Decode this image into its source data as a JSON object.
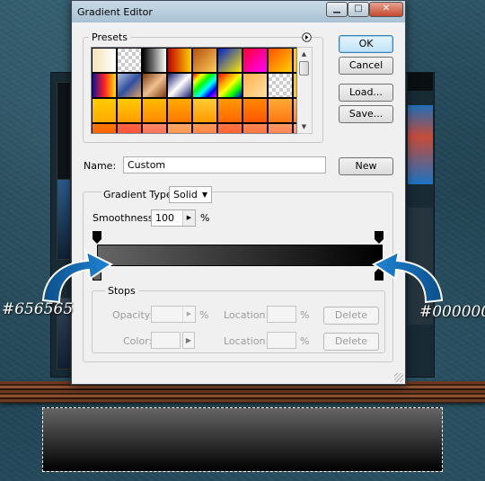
{
  "window": {
    "title": "Gradient Editor",
    "controls": {
      "minimize": "▁",
      "maximize": "□",
      "close": "✕"
    }
  },
  "presets": {
    "legend": "Presets",
    "menu_icon": "circle-arrow-icon",
    "swatches": [
      "linear-gradient(90deg,#f5e3b8,#ffffff)",
      "checker",
      "linear-gradient(90deg,#000,#fff)",
      "linear-gradient(90deg,#c00000,#ffd000)",
      "linear-gradient(135deg,#b45010,#ffcc55)",
      "linear-gradient(135deg,#0020d0,#ffeb00)",
      "linear-gradient(135deg,#ff0030,#ff00ff)",
      "linear-gradient(135deg,#ff5000,#ffd000)",
      "linear-gradient(90deg,#ffd000,#ff8000)",
      "linear-gradient(90deg,#1010a0,#ff2020,#ffe000)",
      "linear-gradient(135deg,#b0c0e0,#3050a0,#e0a060)",
      "linear-gradient(135deg,#7a3a10,#f0c090,#7a3a10)",
      "linear-gradient(135deg,#1a1a6e,#fff 50%,#1a1a6e)",
      "linear-gradient(135deg,#ff0000,#ffff00,#00ff00,#00ffff,#0000ff,#ff00ff)",
      "linear-gradient(135deg,#ff0000,#ff8800,#ffff00,#00ff00,#0000ff)",
      "linear-gradient(135deg,#ffb050,#ffe0a0)",
      "checker",
      "linear-gradient(90deg,#ffd000,#ff9000)",
      "linear-gradient(#ffcc00,#ffaa00)",
      "linear-gradient(#ffcc00,#ff9900)",
      "linear-gradient(#ffbb00,#ff8800)",
      "linear-gradient(#ffaa00,#ff7700)",
      "linear-gradient(#ffcc33,#ff9900)",
      "linear-gradient(#ff9900,#ff6600)",
      "linear-gradient(#ff8800,#ff5500)",
      "linear-gradient(#ffaa33,#ff7711)",
      "linear-gradient(#ffbb44,#ff8822)",
      "linear-gradient(#ff7700,#ff4400)",
      "linear-gradient(#ff6644,#ff3322)",
      "linear-gradient(#ff8866,#ff5544)",
      "linear-gradient(#ffaa66,#ff7733)",
      "linear-gradient(#ff9955,#ff6622)",
      "linear-gradient(#ff7744,#ff4411)",
      "linear-gradient(#ff8855,#ff5522)",
      "linear-gradient(#ff9966,#ff6633)",
      "linear-gradient(#ffaa77,#ff7744)"
    ]
  },
  "buttons": {
    "ok": "OK",
    "cancel": "Cancel",
    "load": "Load...",
    "save": "Save...",
    "new": "New"
  },
  "name": {
    "label": "Name:",
    "value": "Custom"
  },
  "gradient": {
    "type_label": "Gradient Type:",
    "type_value": "Solid",
    "smoothness_label": "Smoothness:",
    "smoothness_value": "100",
    "smoothness_unit": "%",
    "colors": [
      "#656565",
      "#000000"
    ]
  },
  "stops": {
    "legend": "Stops",
    "opacity_label": "Opacity:",
    "opacity_unit": "%",
    "location_label": "Location:",
    "location_unit": "%",
    "color_label": "Color:",
    "delete_label": "Delete"
  },
  "annotations": {
    "left_hex": "#656565",
    "right_hex": "#000000"
  },
  "bottom_preview": {
    "colors": [
      "#656565",
      "#000000"
    ]
  }
}
